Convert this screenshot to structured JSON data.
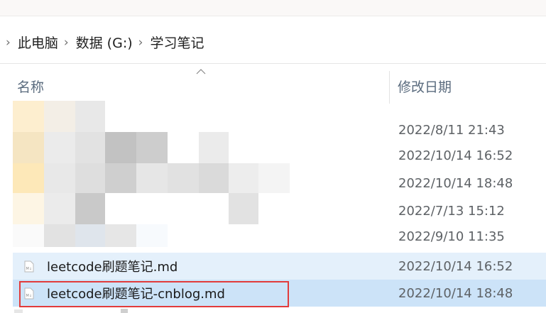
{
  "breadcrumb": {
    "items": [
      "此电脑",
      "数据 (G:)",
      "学习笔记"
    ],
    "separator": "›"
  },
  "columns": {
    "name": "名称",
    "date_modified": "修改日期"
  },
  "rows": [
    {
      "name": "",
      "date": "2022/8/11 21:43",
      "blurred": true
    },
    {
      "name": "",
      "date": "2022/10/14 16:52",
      "blurred": true
    },
    {
      "name": "",
      "date": "2022/10/14 18:48",
      "blurred": true
    },
    {
      "name": "",
      "date": "2022/7/13 15:12",
      "blurred": true
    },
    {
      "name": "",
      "date": "2022/9/10 11:35",
      "blurred": true
    },
    {
      "name": "leetcode刷题笔记.md",
      "date": "2022/10/14 16:52",
      "state": "hover"
    },
    {
      "name": "leetcode刷题笔记-cnblog.md",
      "date": "2022/10/14 18:48",
      "state": "selected"
    }
  ],
  "icons": {
    "file_icon": "markdown-file-icon",
    "sort": "chevron-up-icon"
  },
  "colors": {
    "hover_row": "#e4f0fb",
    "selected_row": "#cce3f8",
    "annotation_box": "#e23b3b"
  }
}
